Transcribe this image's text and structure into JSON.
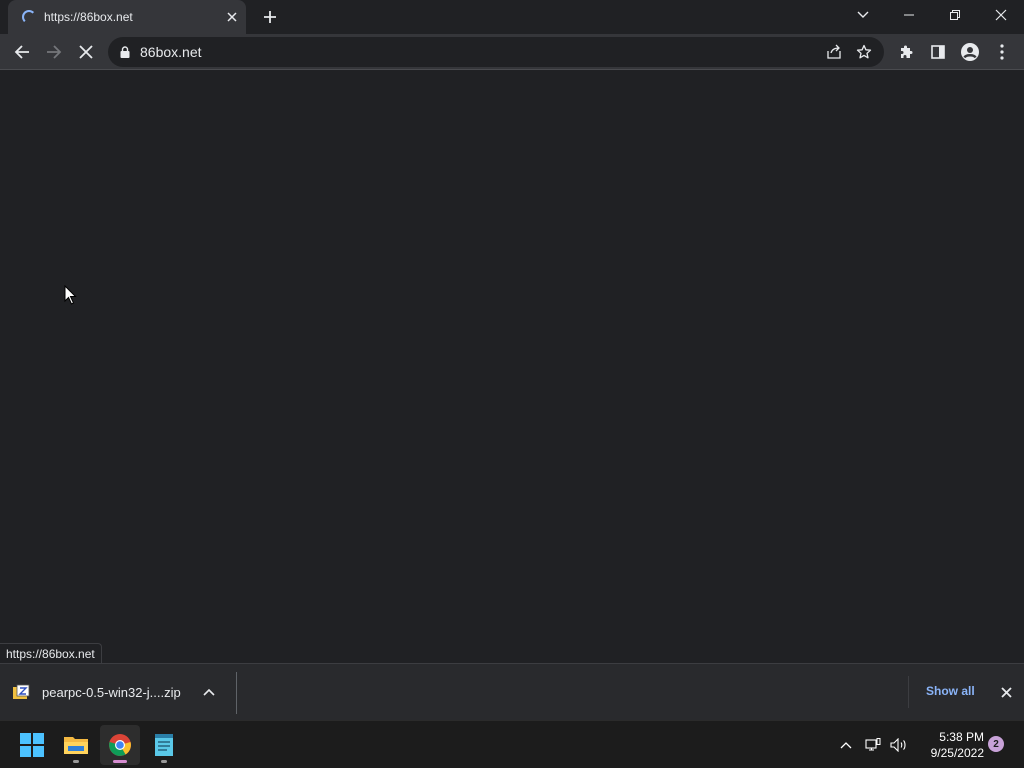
{
  "tab": {
    "title": "https://86box.net"
  },
  "omnibox": {
    "url": "86box.net"
  },
  "status_bar": {
    "url": "https://86box.net"
  },
  "download": {
    "filename": "pearpc-0.5-win32-j....zip",
    "show_all": "Show all"
  },
  "taskbar": {
    "time": "5:38 PM",
    "date": "9/25/2022",
    "notification_count": "2"
  },
  "colors": {
    "accent": "#8ab4f8",
    "chrome_bg": "#202124",
    "toolbar_bg": "#35363a"
  }
}
